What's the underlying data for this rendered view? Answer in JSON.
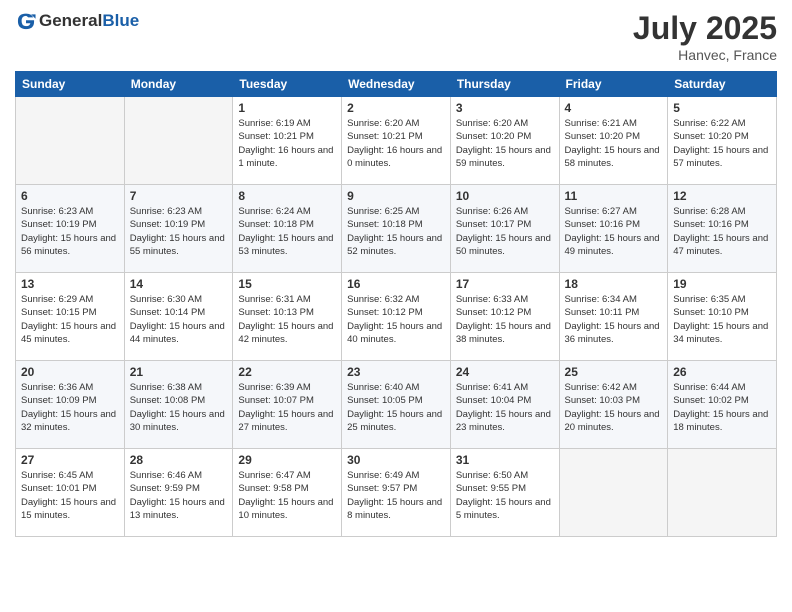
{
  "header": {
    "logo_general": "General",
    "logo_blue": "Blue",
    "month_year": "July 2025",
    "location": "Hanvec, France"
  },
  "days_of_week": [
    "Sunday",
    "Monday",
    "Tuesday",
    "Wednesday",
    "Thursday",
    "Friday",
    "Saturday"
  ],
  "weeks": [
    [
      {
        "day": "",
        "sunrise": "",
        "sunset": "",
        "daylight": "",
        "empty": true
      },
      {
        "day": "",
        "sunrise": "",
        "sunset": "",
        "daylight": "",
        "empty": true
      },
      {
        "day": "1",
        "sunrise": "Sunrise: 6:19 AM",
        "sunset": "Sunset: 10:21 PM",
        "daylight": "Daylight: 16 hours and 1 minute.",
        "empty": false
      },
      {
        "day": "2",
        "sunrise": "Sunrise: 6:20 AM",
        "sunset": "Sunset: 10:21 PM",
        "daylight": "Daylight: 16 hours and 0 minutes.",
        "empty": false
      },
      {
        "day": "3",
        "sunrise": "Sunrise: 6:20 AM",
        "sunset": "Sunset: 10:20 PM",
        "daylight": "Daylight: 15 hours and 59 minutes.",
        "empty": false
      },
      {
        "day": "4",
        "sunrise": "Sunrise: 6:21 AM",
        "sunset": "Sunset: 10:20 PM",
        "daylight": "Daylight: 15 hours and 58 minutes.",
        "empty": false
      },
      {
        "day": "5",
        "sunrise": "Sunrise: 6:22 AM",
        "sunset": "Sunset: 10:20 PM",
        "daylight": "Daylight: 15 hours and 57 minutes.",
        "empty": false
      }
    ],
    [
      {
        "day": "6",
        "sunrise": "Sunrise: 6:23 AM",
        "sunset": "Sunset: 10:19 PM",
        "daylight": "Daylight: 15 hours and 56 minutes.",
        "empty": false
      },
      {
        "day": "7",
        "sunrise": "Sunrise: 6:23 AM",
        "sunset": "Sunset: 10:19 PM",
        "daylight": "Daylight: 15 hours and 55 minutes.",
        "empty": false
      },
      {
        "day": "8",
        "sunrise": "Sunrise: 6:24 AM",
        "sunset": "Sunset: 10:18 PM",
        "daylight": "Daylight: 15 hours and 53 minutes.",
        "empty": false
      },
      {
        "day": "9",
        "sunrise": "Sunrise: 6:25 AM",
        "sunset": "Sunset: 10:18 PM",
        "daylight": "Daylight: 15 hours and 52 minutes.",
        "empty": false
      },
      {
        "day": "10",
        "sunrise": "Sunrise: 6:26 AM",
        "sunset": "Sunset: 10:17 PM",
        "daylight": "Daylight: 15 hours and 50 minutes.",
        "empty": false
      },
      {
        "day": "11",
        "sunrise": "Sunrise: 6:27 AM",
        "sunset": "Sunset: 10:16 PM",
        "daylight": "Daylight: 15 hours and 49 minutes.",
        "empty": false
      },
      {
        "day": "12",
        "sunrise": "Sunrise: 6:28 AM",
        "sunset": "Sunset: 10:16 PM",
        "daylight": "Daylight: 15 hours and 47 minutes.",
        "empty": false
      }
    ],
    [
      {
        "day": "13",
        "sunrise": "Sunrise: 6:29 AM",
        "sunset": "Sunset: 10:15 PM",
        "daylight": "Daylight: 15 hours and 45 minutes.",
        "empty": false
      },
      {
        "day": "14",
        "sunrise": "Sunrise: 6:30 AM",
        "sunset": "Sunset: 10:14 PM",
        "daylight": "Daylight: 15 hours and 44 minutes.",
        "empty": false
      },
      {
        "day": "15",
        "sunrise": "Sunrise: 6:31 AM",
        "sunset": "Sunset: 10:13 PM",
        "daylight": "Daylight: 15 hours and 42 minutes.",
        "empty": false
      },
      {
        "day": "16",
        "sunrise": "Sunrise: 6:32 AM",
        "sunset": "Sunset: 10:12 PM",
        "daylight": "Daylight: 15 hours and 40 minutes.",
        "empty": false
      },
      {
        "day": "17",
        "sunrise": "Sunrise: 6:33 AM",
        "sunset": "Sunset: 10:12 PM",
        "daylight": "Daylight: 15 hours and 38 minutes.",
        "empty": false
      },
      {
        "day": "18",
        "sunrise": "Sunrise: 6:34 AM",
        "sunset": "Sunset: 10:11 PM",
        "daylight": "Daylight: 15 hours and 36 minutes.",
        "empty": false
      },
      {
        "day": "19",
        "sunrise": "Sunrise: 6:35 AM",
        "sunset": "Sunset: 10:10 PM",
        "daylight": "Daylight: 15 hours and 34 minutes.",
        "empty": false
      }
    ],
    [
      {
        "day": "20",
        "sunrise": "Sunrise: 6:36 AM",
        "sunset": "Sunset: 10:09 PM",
        "daylight": "Daylight: 15 hours and 32 minutes.",
        "empty": false
      },
      {
        "day": "21",
        "sunrise": "Sunrise: 6:38 AM",
        "sunset": "Sunset: 10:08 PM",
        "daylight": "Daylight: 15 hours and 30 minutes.",
        "empty": false
      },
      {
        "day": "22",
        "sunrise": "Sunrise: 6:39 AM",
        "sunset": "Sunset: 10:07 PM",
        "daylight": "Daylight: 15 hours and 27 minutes.",
        "empty": false
      },
      {
        "day": "23",
        "sunrise": "Sunrise: 6:40 AM",
        "sunset": "Sunset: 10:05 PM",
        "daylight": "Daylight: 15 hours and 25 minutes.",
        "empty": false
      },
      {
        "day": "24",
        "sunrise": "Sunrise: 6:41 AM",
        "sunset": "Sunset: 10:04 PM",
        "daylight": "Daylight: 15 hours and 23 minutes.",
        "empty": false
      },
      {
        "day": "25",
        "sunrise": "Sunrise: 6:42 AM",
        "sunset": "Sunset: 10:03 PM",
        "daylight": "Daylight: 15 hours and 20 minutes.",
        "empty": false
      },
      {
        "day": "26",
        "sunrise": "Sunrise: 6:44 AM",
        "sunset": "Sunset: 10:02 PM",
        "daylight": "Daylight: 15 hours and 18 minutes.",
        "empty": false
      }
    ],
    [
      {
        "day": "27",
        "sunrise": "Sunrise: 6:45 AM",
        "sunset": "Sunset: 10:01 PM",
        "daylight": "Daylight: 15 hours and 15 minutes.",
        "empty": false
      },
      {
        "day": "28",
        "sunrise": "Sunrise: 6:46 AM",
        "sunset": "Sunset: 9:59 PM",
        "daylight": "Daylight: 15 hours and 13 minutes.",
        "empty": false
      },
      {
        "day": "29",
        "sunrise": "Sunrise: 6:47 AM",
        "sunset": "Sunset: 9:58 PM",
        "daylight": "Daylight: 15 hours and 10 minutes.",
        "empty": false
      },
      {
        "day": "30",
        "sunrise": "Sunrise: 6:49 AM",
        "sunset": "Sunset: 9:57 PM",
        "daylight": "Daylight: 15 hours and 8 minutes.",
        "empty": false
      },
      {
        "day": "31",
        "sunrise": "Sunrise: 6:50 AM",
        "sunset": "Sunset: 9:55 PM",
        "daylight": "Daylight: 15 hours and 5 minutes.",
        "empty": false
      },
      {
        "day": "",
        "sunrise": "",
        "sunset": "",
        "daylight": "",
        "empty": true
      },
      {
        "day": "",
        "sunrise": "",
        "sunset": "",
        "daylight": "",
        "empty": true
      }
    ]
  ]
}
